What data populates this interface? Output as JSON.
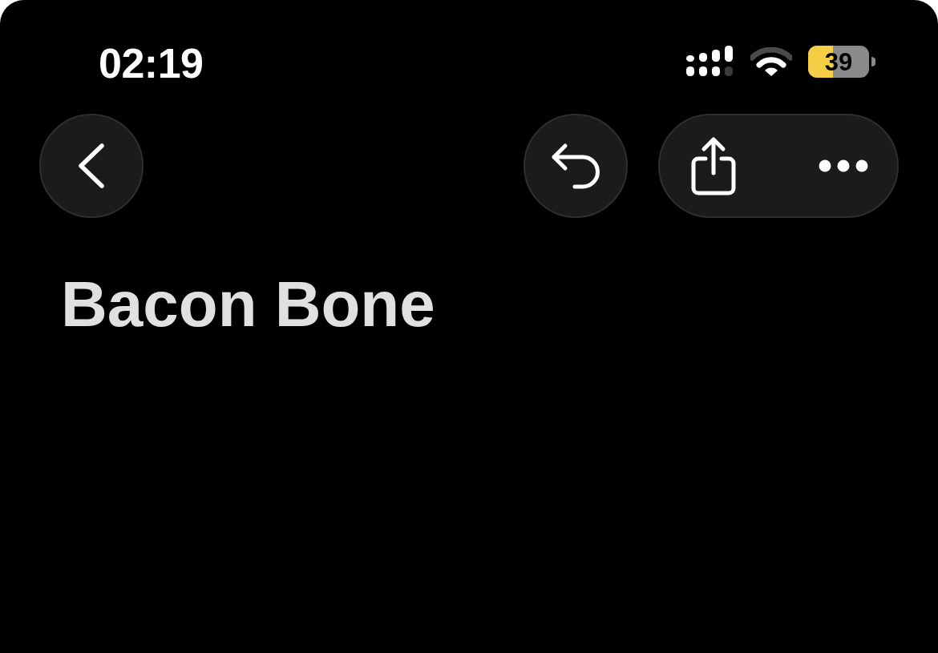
{
  "status_bar": {
    "time": "02:19",
    "battery": {
      "percent": "39",
      "low_power": true
    }
  },
  "title": "Bacon Bone"
}
